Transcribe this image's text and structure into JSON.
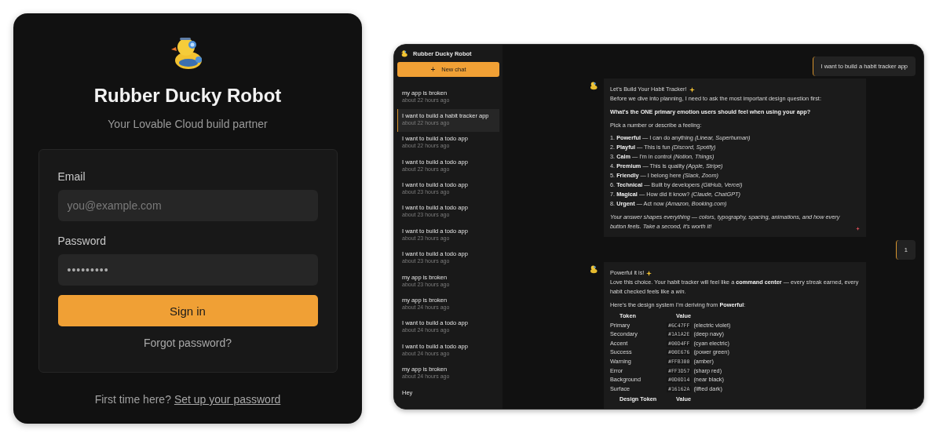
{
  "login": {
    "title": "Rubber Ducky Robot",
    "subtitle": "Your Lovable Cloud build partner",
    "email": {
      "label": "Email",
      "placeholder": "you@example.com"
    },
    "password": {
      "label": "Password",
      "value": "•••••••••"
    },
    "sign_in": "Sign in",
    "forgot": "Forgot password?",
    "footer": "First time here?",
    "footer_link": "Set up your password"
  },
  "chat_app": {
    "sidebar": {
      "title": "Rubber Ducky Robot",
      "new_chat_icon": "+",
      "new_chat": "New chat",
      "items": [
        {
          "title": "my app is broken",
          "time": "about 22 hours ago",
          "selected": false
        },
        {
          "title": "I want to build a habit tracker app",
          "time": "about 22 hours ago",
          "selected": true
        },
        {
          "title": "I want to build a todo app",
          "time": "about 22 hours ago",
          "selected": false
        },
        {
          "title": "I want to build a todo app",
          "time": "about 22 hours ago",
          "selected": false
        },
        {
          "title": "I want to build a todo app",
          "time": "about 23 hours ago",
          "selected": false
        },
        {
          "title": "I want to build a todo app",
          "time": "about 23 hours ago",
          "selected": false
        },
        {
          "title": "I want to build a todo app",
          "time": "about 23 hours ago",
          "selected": false
        },
        {
          "title": "I want to build a todo app",
          "time": "about 23 hours ago",
          "selected": false
        },
        {
          "title": "my app is broken",
          "time": "about 23 hours ago",
          "selected": false
        },
        {
          "title": "my app is broken",
          "time": "about 24 hours ago",
          "selected": false
        },
        {
          "title": "I want to build a todo app",
          "time": "about 24 hours ago",
          "selected": false
        },
        {
          "title": "I want to build a todo app",
          "time": "about 24 hours ago",
          "selected": false
        },
        {
          "title": "my app is broken",
          "time": "about 24 hours ago",
          "selected": false
        },
        {
          "title": "Hey",
          "selected": false
        }
      ]
    },
    "messages": [
      {
        "kind": "user",
        "text": "I want to build a habit tracker app"
      },
      {
        "kind": "assistant",
        "blocks": [
          {
            "kind": "title",
            "text": "Let's Build Your Habit Tracker!"
          },
          {
            "kind": "text",
            "text": "Before we dive into planning, I need to ask the most important design question first:"
          },
          {
            "kind": "strong",
            "text": "What's the ONE primary emotion users should feel when using your app?"
          },
          {
            "kind": "text",
            "text": "Pick a number or describe a feeling:"
          },
          {
            "kind": "list",
            "items": [
              "1. **Powerful** — I can do anything *(Linear, Superhuman)*",
              "2. **Playful** — This is fun *(Discord, Spotify)*",
              "3. **Calm** — I'm in control *(Notion, Things)*",
              "4. **Premium** — This is quality *(Apple, Stripe)*",
              "5. **Friendly** — I belong here *(Slack, Zoom)*",
              "6. **Technical** — Built by developers *(GitHub, Vercel)*",
              "7. **Magical** — How did it know? *(Claude, ChatGPT)*",
              "8. **Urgent** — Act now *(Amazon, Booking.com)*"
            ]
          },
          {
            "kind": "note",
            "text": "Your answer shapes everything — colors, typography, spacing, animations, and how every button feels. Take a second, it's worth it!"
          }
        ]
      },
      {
        "kind": "user",
        "text": "1"
      },
      {
        "kind": "assistant",
        "blocks": [
          {
            "kind": "title",
            "text": "Powerful it is!"
          },
          {
            "kind": "text",
            "text": "Love this choice. Your habit tracker will feel like a **command center** — every streak earned, every habit checked feels like a *win*."
          },
          {
            "kind": "text",
            "text": "Here's the design system I'm deriving from **Powerful**:"
          },
          {
            "kind": "table",
            "columns": [
              "Token",
              "Value"
            ],
            "rows": [
              {
                "name": "Primary",
                "code": "#6C47FF",
                "note": "(electric violet)"
              },
              {
                "name": "Secondary",
                "code": "#1A1A2E",
                "note": "(deep navy)"
              },
              {
                "name": "Accent",
                "code": "#00D4FF",
                "note": "(cyan electric)"
              },
              {
                "name": "Success",
                "code": "#00E676",
                "note": "(power green)"
              },
              {
                "name": "Warning",
                "code": "#FFB300",
                "note": "(amber)"
              },
              {
                "name": "Error",
                "code": "#FF3D57",
                "note": "(sharp red)"
              },
              {
                "name": "Background",
                "code": "#0D0D14",
                "note": "(near black)"
              },
              {
                "name": "Surface",
                "code": "#16162A",
                "note": "(lifted dark)"
              }
            ]
          },
          {
            "kind": "table",
            "columns": [
              "Design Token",
              "Value"
            ]
          }
        ]
      }
    ]
  }
}
